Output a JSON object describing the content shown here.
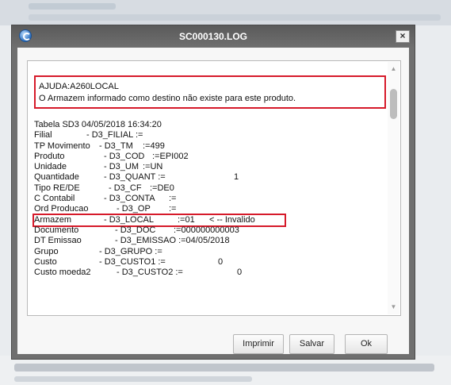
{
  "window": {
    "title": "SC000130.LOG"
  },
  "log": {
    "help_title": "AJUDA:A260LOCAL",
    "help_message": "O Armazem  informado  como  destino não existe para este produto.",
    "table_header": "Tabela SD3 04/05/2018 16:34:20",
    "rows": [
      {
        "label": "Filial",
        "field": "- D3_FILIAL  :=",
        "value": "",
        "note": ""
      },
      {
        "label": "TP Movimento",
        "field": "- D3_TM",
        "value": ":=499",
        "note": ""
      },
      {
        "label": "Produto",
        "field": "- D3_COD",
        "value": ":=EPI002",
        "note": ""
      },
      {
        "label": "Unidade",
        "field": "- D3_UM",
        "value": ":=UN",
        "note": ""
      },
      {
        "label": "Quantidade",
        "field": "- D3_QUANT  :=",
        "value": "1",
        "note": ""
      },
      {
        "label": "Tipo RE/DE",
        "field": "- D3_CF",
        "value": ":=DE0",
        "note": ""
      },
      {
        "label": "C Contabil",
        "field": "- D3_CONTA",
        "value": ":=",
        "note": ""
      },
      {
        "label": "Ord Producao",
        "field": "- D3_OP",
        "value": ":=",
        "note": ""
      },
      {
        "label": "Armazem",
        "field": "- D3_LOCAL",
        "value": ":=01",
        "note": "< -- Invalido"
      },
      {
        "label": "Documento",
        "field": "- D3_DOC",
        "value": ":=000000000003",
        "note": ""
      },
      {
        "label": "DT Emissao",
        "field": "- D3_EMISSAO :=04/05/2018",
        "value": "",
        "note": ""
      },
      {
        "label": "Grupo",
        "field": "- D3_GRUPO  :=",
        "value": "",
        "note": ""
      },
      {
        "label": "Custo",
        "field": "- D3_CUSTO1  :=",
        "value": "0",
        "note": ""
      },
      {
        "label": "Custo moeda2",
        "field": "- D3_CUSTO2  :=",
        "value": "0",
        "note": ""
      }
    ]
  },
  "buttons": {
    "print": "Imprimir",
    "save": "Salvar",
    "ok": "Ok"
  },
  "icons": {
    "app": "totvs-app-icon",
    "close": "close-icon",
    "scroll_up": "scroll-up-arrow-icon",
    "scroll_down": "scroll-down-arrow-icon"
  },
  "colors": {
    "highlight": "#d61a2a",
    "titlebar": "#6f6f6f"
  }
}
